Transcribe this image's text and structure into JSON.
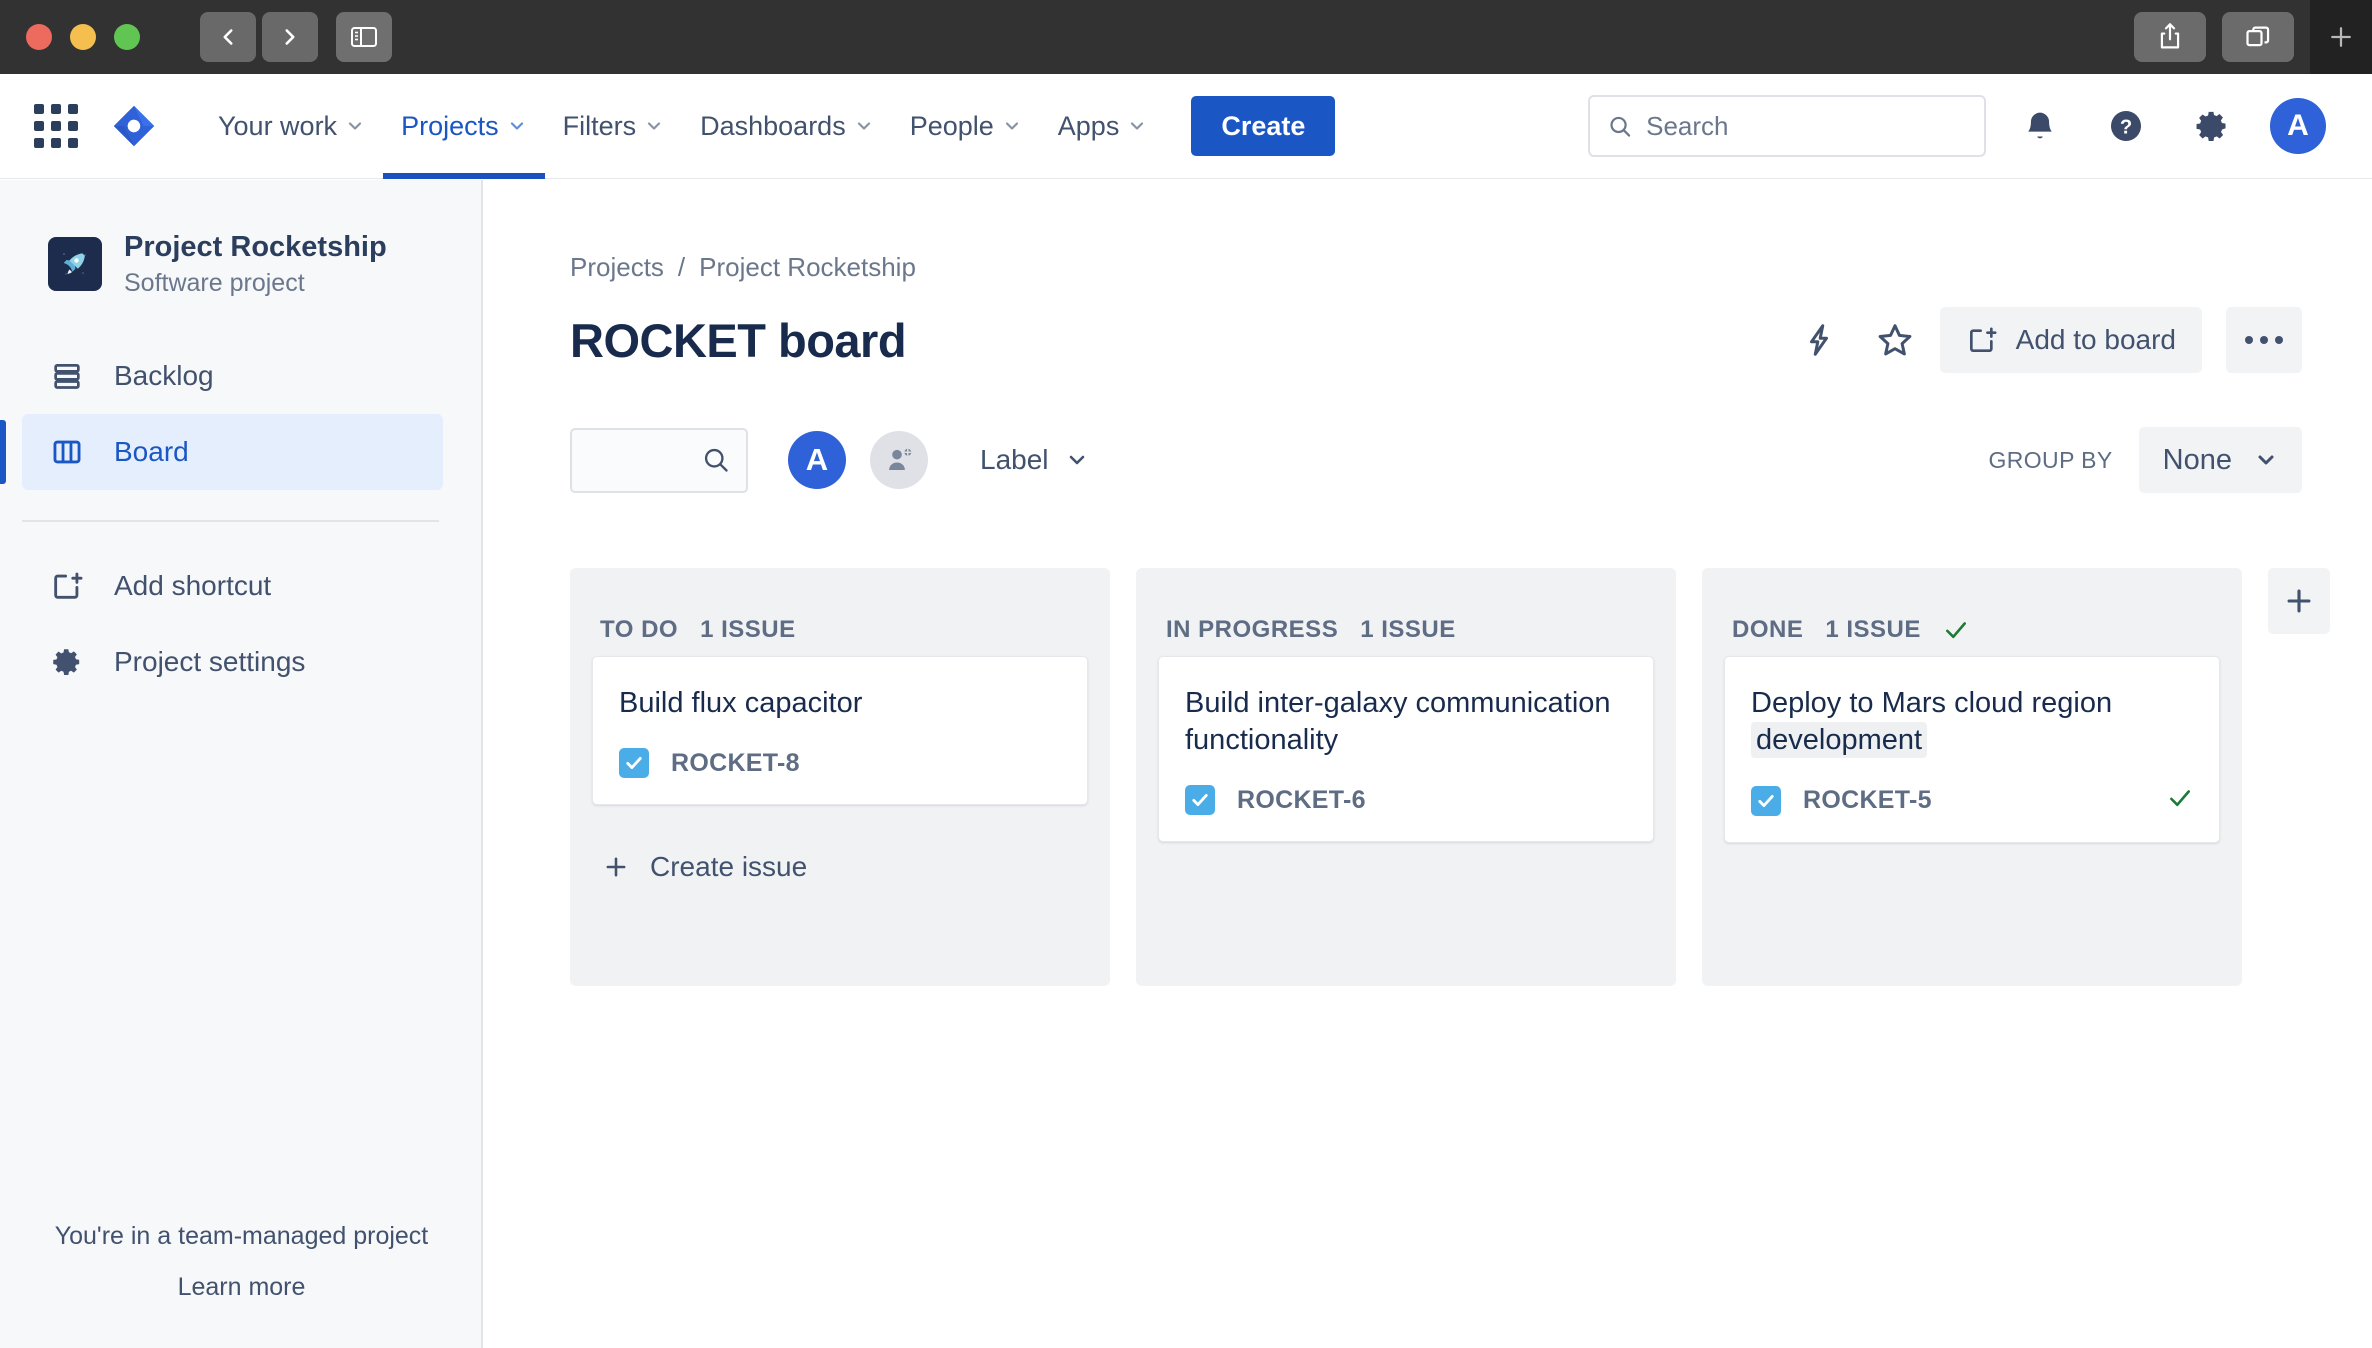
{
  "window": {
    "traffic_lights": [
      "close",
      "minimize",
      "zoom"
    ],
    "back_label": "Back",
    "forward_label": "Forward",
    "sidebar_toggle_label": "Toggle Sidebar",
    "share_label": "Share",
    "tabs_label": "Show Tab Overview",
    "new_tab_label": "New Tab"
  },
  "globalnav": {
    "app_switcher_label": "App switcher",
    "logo_label": "Jira",
    "links": [
      {
        "label": "Your work",
        "active": false,
        "has_chevron": true
      },
      {
        "label": "Projects",
        "active": true,
        "has_chevron": true
      },
      {
        "label": "Filters",
        "active": false,
        "has_chevron": true
      },
      {
        "label": "Dashboards",
        "active": false,
        "has_chevron": true
      },
      {
        "label": "People",
        "active": false,
        "has_chevron": true
      },
      {
        "label": "Apps",
        "active": false,
        "has_chevron": true
      }
    ],
    "create_label": "Create",
    "search": {
      "value": "",
      "placeholder": "Search"
    },
    "notifications_label": "Notifications",
    "help_label": "Help",
    "settings_label": "Settings",
    "avatar_initial": "A"
  },
  "sidebar": {
    "project": {
      "name": "Project Rocketship",
      "type": "Software project",
      "avatar_glyph": "🚀"
    },
    "items": [
      {
        "label": "Backlog",
        "icon": "backlog-icon",
        "active": false
      },
      {
        "label": "Board",
        "icon": "board-icon",
        "active": true
      }
    ],
    "items_secondary": [
      {
        "label": "Add shortcut",
        "icon": "add-shortcut-icon"
      },
      {
        "label": "Project settings",
        "icon": "gear-icon"
      }
    ],
    "footer": {
      "notice": "You're in a team-managed project",
      "link": "Learn more"
    }
  },
  "main": {
    "breadcrumb": [
      "Projects",
      "Project Rocketship"
    ],
    "breadcrumb_separator": "/",
    "title": "ROCKET board",
    "actions": {
      "automation_label": "Automation",
      "star_label": "Add to starred",
      "add_to_board_label": "Add to board",
      "more_label": "More actions"
    },
    "toolbar": {
      "search": {
        "value": "",
        "placeholder": ""
      },
      "avatar_initial": "A",
      "add_people_label": "Add people",
      "label_filter": "Label",
      "group_by_label": "GROUP BY",
      "group_by_value": "None"
    },
    "board": {
      "add_column_label": "Add column",
      "columns": [
        {
          "name": "TO DO",
          "count_label": "1 ISSUE",
          "done": false,
          "create_issue_label": "Create issue",
          "show_create_issue": true,
          "cards": [
            {
              "title": "Build flux capacitor",
              "title_highlight": "",
              "key": "ROCKET-8",
              "type_icon": "task-checkbox-icon",
              "done": false
            }
          ]
        },
        {
          "name": "IN PROGRESS",
          "count_label": "1 ISSUE",
          "done": false,
          "create_issue_label": "Create issue",
          "show_create_issue": false,
          "cards": [
            {
              "title": "Build inter-galaxy communication functionality",
              "title_highlight": "",
              "key": "ROCKET-6",
              "type_icon": "task-checkbox-icon",
              "done": false
            }
          ]
        },
        {
          "name": "DONE",
          "count_label": "1 ISSUE",
          "done": true,
          "create_issue_label": "Create issue",
          "show_create_issue": false,
          "cards": [
            {
              "title": "Deploy to Mars cloud region ",
              "title_highlight": "development",
              "key": "ROCKET-5",
              "type_icon": "task-checkbox-icon",
              "done": true
            }
          ]
        }
      ]
    }
  },
  "colors": {
    "brand_blue": "#1a56c4",
    "avatar_blue": "#2f62d8",
    "task_icon_blue": "#4bade8",
    "done_green": "#1d7a36",
    "column_bg": "#f1f2f4",
    "sidebar_bg": "#f7f8f9",
    "titlebar_bg": "#323232"
  }
}
